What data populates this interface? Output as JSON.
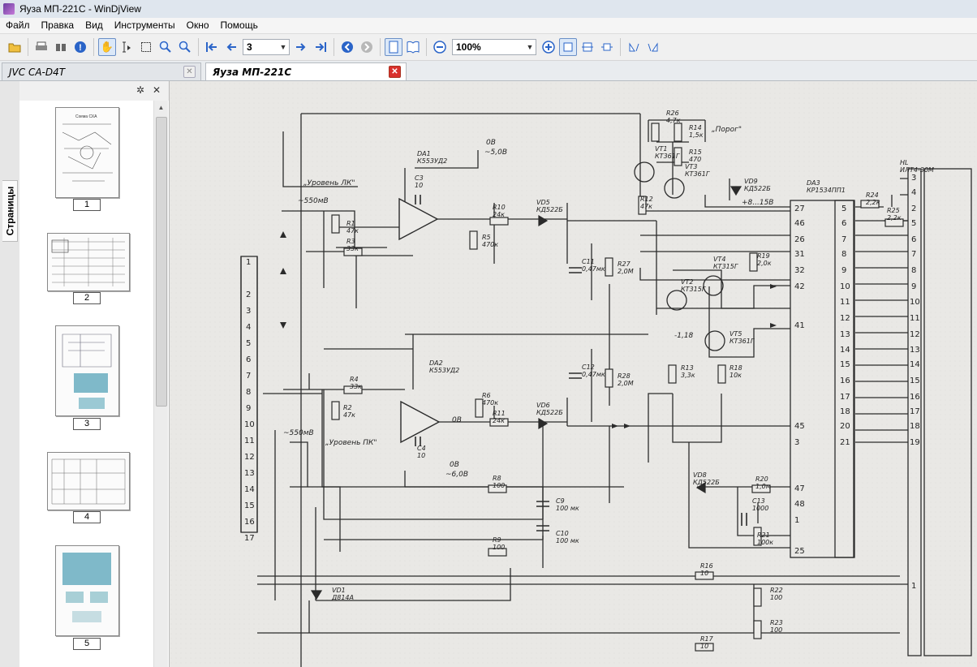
{
  "window": {
    "title": "Яуза МП-221С - WinDjView"
  },
  "menu": {
    "items": [
      "Файл",
      "Правка",
      "Вид",
      "Инструменты",
      "Окно",
      "Помощь"
    ]
  },
  "toolbar": {
    "page_value": "3",
    "zoom_value": "100%"
  },
  "tabs": [
    {
      "label": "JVC CA-D4T",
      "active": false
    },
    {
      "label": "Яуза МП-221С",
      "active": true
    }
  ],
  "sidebar": {
    "tab_label": "Страницы",
    "pages": [
      {
        "label": "1"
      },
      {
        "label": "2"
      },
      {
        "label": "3"
      },
      {
        "label": "4"
      },
      {
        "label": "5"
      }
    ]
  },
  "schematic": {
    "labels": {
      "uroven_lk": "„Уровень ЛК\"",
      "uroven_pk": "„Уровень ПК\"",
      "v550_top": "~550мВ",
      "v550_bot": "~550мВ",
      "poros": "„Порог\"",
      "d0_top": "0В",
      "d0_top_v": "~5,0В",
      "d0_bot": "0В",
      "d0_bot_v": "~6,0В",
      "v018": "-1,18",
      "v8_15": "+8...15В",
      "out_0b": "0В"
    },
    "parts": [
      {
        "ref": "DA1",
        "val": "К553УД2"
      },
      {
        "ref": "DA2",
        "val": "К553УД2"
      },
      {
        "ref": "DA3",
        "val": "КР1534ПП1"
      },
      {
        "ref": "HL",
        "val": "ИЛТ4-30М"
      },
      {
        "ref": "C3",
        "val": "10"
      },
      {
        "ref": "C4",
        "val": "10"
      },
      {
        "ref": "R1",
        "val": "47к"
      },
      {
        "ref": "R2",
        "val": "47к"
      },
      {
        "ref": "R3",
        "val": "33к"
      },
      {
        "ref": "R4",
        "val": "33к"
      },
      {
        "ref": "R5",
        "val": "470к"
      },
      {
        "ref": "R6",
        "val": "470к"
      },
      {
        "ref": "R10",
        "val": "24к"
      },
      {
        "ref": "R11",
        "val": "24к"
      },
      {
        "ref": "VD5",
        "val": "КД522Б"
      },
      {
        "ref": "VD6",
        "val": "КД522Б"
      },
      {
        "ref": "C11",
        "val": "0,47мк"
      },
      {
        "ref": "C12",
        "val": "0,47мк"
      },
      {
        "ref": "R27",
        "val": "2,0М"
      },
      {
        "ref": "R28",
        "val": "2,0М"
      },
      {
        "ref": "R26",
        "val": "4,7к"
      },
      {
        "ref": "R14",
        "val": "1,5к"
      },
      {
        "ref": "R15",
        "val": "470"
      },
      {
        "ref": "VT1",
        "val": "КТ361Г"
      },
      {
        "ref": "VT3",
        "val": "КТ361Г"
      },
      {
        "ref": "R12",
        "val": "47к"
      },
      {
        "ref": "VD9",
        "val": "КД522Б"
      },
      {
        "ref": "R24",
        "val": "2,2к"
      },
      {
        "ref": "R25",
        "val": "2,2к"
      },
      {
        "ref": "VT4",
        "val": "КТ315Г"
      },
      {
        "ref": "R19",
        "val": "2,0к"
      },
      {
        "ref": "VT2",
        "val": "КТ315Г"
      },
      {
        "ref": "VT5",
        "val": "КТ361Г"
      },
      {
        "ref": "R13",
        "val": "3,3к"
      },
      {
        "ref": "R18",
        "val": "10к"
      },
      {
        "ref": "VD8",
        "val": "КД522Б"
      },
      {
        "ref": "R20",
        "val": "1,0м"
      },
      {
        "ref": "C13",
        "val": "1000"
      },
      {
        "ref": "R21",
        "val": "100к"
      },
      {
        "ref": "R8",
        "val": "100"
      },
      {
        "ref": "C9",
        "val": "100 мк"
      },
      {
        "ref": "R9",
        "val": "100"
      },
      {
        "ref": "C10",
        "val": "100 мк"
      },
      {
        "ref": "R16",
        "val": "10"
      },
      {
        "ref": "R17",
        "val": "10"
      },
      {
        "ref": "R22",
        "val": "100"
      },
      {
        "ref": "R23",
        "val": "100"
      },
      {
        "ref": "VD1",
        "val": "Д814А"
      }
    ],
    "connector_pins": [
      "1",
      "2",
      "3",
      "4",
      "5",
      "6",
      "7",
      "8",
      "9",
      "10",
      "11",
      "12",
      "13",
      "14",
      "15",
      "16",
      "17"
    ],
    "da3_pins_left": [
      "27",
      "46",
      "26",
      "31",
      "32",
      "42",
      "41",
      "45",
      "3",
      "47",
      "48",
      "1",
      "25"
    ],
    "da3_pins_right": [
      "5",
      "6",
      "7",
      "8",
      "9",
      "10",
      "11",
      "12",
      "13",
      "14",
      "15",
      "16",
      "17",
      "18",
      "20",
      "21"
    ],
    "hl_pins": [
      "3",
      "4",
      "2",
      "5",
      "6",
      "7",
      "8",
      "9",
      "10",
      "11",
      "12",
      "13",
      "14",
      "15",
      "16",
      "17",
      "18",
      "19",
      "1"
    ]
  }
}
